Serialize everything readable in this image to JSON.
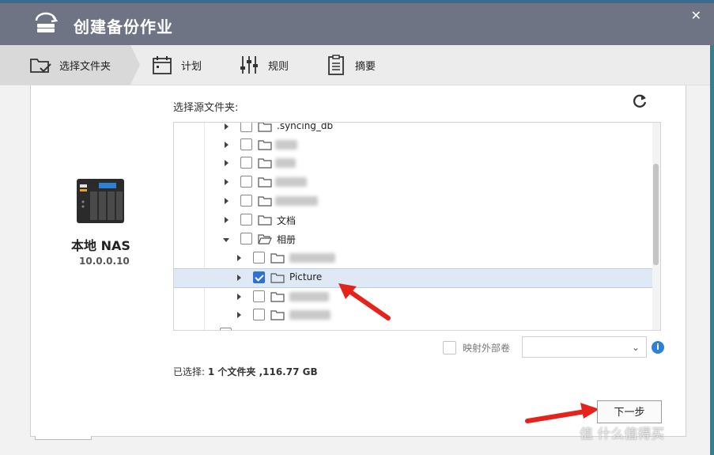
{
  "window": {
    "title": "创建备份作业",
    "close_symbol": "✕"
  },
  "steps": [
    {
      "label": "选择文件夹",
      "icon": "folder-check-icon",
      "active": true
    },
    {
      "label": "计划",
      "icon": "calendar-icon",
      "active": false
    },
    {
      "label": "规则",
      "icon": "sliders-icon",
      "active": false
    },
    {
      "label": "摘要",
      "icon": "clipboard-icon",
      "active": false
    }
  ],
  "device": {
    "name": "本地 NAS",
    "ip": "10.0.0.10"
  },
  "source": {
    "label": "选择源文件夹:"
  },
  "tree": {
    "rows": [
      {
        "name": ".syncing_db",
        "checked": false,
        "expanded": false,
        "blurred": false
      },
      {
        "name": "",
        "checked": false,
        "expanded": false,
        "blurred": true
      },
      {
        "name": "",
        "checked": false,
        "expanded": false,
        "blurred": true
      },
      {
        "name": "",
        "checked": false,
        "expanded": false,
        "blurred": true
      },
      {
        "name": "",
        "checked": false,
        "expanded": false,
        "blurred": true
      },
      {
        "name": "文档",
        "checked": false,
        "expanded": false,
        "blurred": false
      },
      {
        "name": "相册",
        "checked": false,
        "expanded": true,
        "blurred": false
      },
      {
        "name": "",
        "checked": false,
        "expanded": false,
        "blurred": true
      },
      {
        "name": "Picture",
        "checked": true,
        "expanded": false,
        "blurred": false
      },
      {
        "name": "",
        "checked": false,
        "expanded": false,
        "blurred": true
      },
      {
        "name": "",
        "checked": false,
        "expanded": false,
        "blurred": true
      }
    ]
  },
  "mapping": {
    "label": "映射外部卷",
    "checked": false,
    "selected_value": ""
  },
  "summary": {
    "prefix": "已选择: ",
    "value": "1 个文件夹 ,116.77 GB"
  },
  "buttons": {
    "next": "下一步"
  },
  "watermark": "值 什么值得买",
  "colors": {
    "title_bar": "#6f7485",
    "accent": "#2f6fd6",
    "arrow": "#e5231b"
  }
}
